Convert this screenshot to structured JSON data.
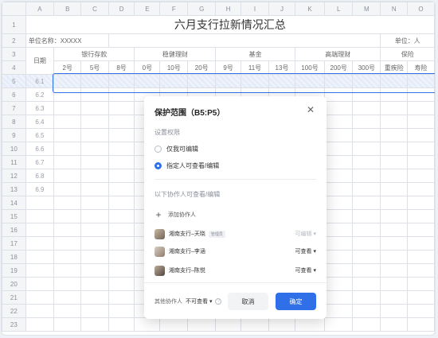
{
  "sheet": {
    "columns": [
      "A",
      "B",
      "C",
      "D",
      "E",
      "F",
      "G",
      "H",
      "I",
      "J",
      "K",
      "L",
      "M",
      "N",
      "O"
    ],
    "title": "六月支行拉新情况汇总",
    "unit_name_label": "单位名称：XXXXX",
    "unit_label": "单位：人",
    "date_header": "日期",
    "groups": [
      "银行存款",
      "稳健理财",
      "基金",
      "高端理财",
      "保险"
    ],
    "subheaders": [
      "2号",
      "5号",
      "8号",
      "0号",
      "10号",
      "20号",
      "9号",
      "11号",
      "13号",
      "100号",
      "200号",
      "300号",
      "重疾险",
      "寿险"
    ],
    "dates": [
      "6.1",
      "6.2",
      "6.3",
      "6.4",
      "6.5",
      "6.6",
      "6.7",
      "6.8",
      "6.9"
    ],
    "row_numbers": [
      "1",
      "2",
      "3",
      "4",
      "5",
      "6",
      "7",
      "8",
      "9",
      "10",
      "11",
      "12",
      "13",
      "14",
      "15",
      "16",
      "17",
      "18",
      "19",
      "20",
      "21",
      "22",
      "23"
    ]
  },
  "dialog": {
    "title": "保护范围（B5:P5）",
    "close_icon": "close-icon",
    "permission_section": "设置权限",
    "option_self": "仅我可编辑",
    "option_specified": "指定人可查看/编辑",
    "selected_option": "option_specified",
    "collaborators_section": "以下协作人可查看/编辑",
    "add_label": "添加协作人",
    "members": [
      {
        "name": "湘南支行–天晓",
        "tag": "管理员",
        "permission": "可编辑 ▾",
        "disabled": true
      },
      {
        "name": "湘南支行–李涵",
        "tag": "",
        "permission": "可查看 ▾",
        "disabled": false
      },
      {
        "name": "湘南支行–陈悦",
        "tag": "",
        "permission": "可查看 ▾",
        "disabled": false
      }
    ],
    "other_label": "其他协作人",
    "other_value": "不可查看 ▾",
    "cancel_label": "取消",
    "confirm_label": "确定"
  },
  "colors": {
    "accent": "#2f6fe8",
    "grid": "#dde1e7",
    "header_bg": "#f4f5f7"
  }
}
